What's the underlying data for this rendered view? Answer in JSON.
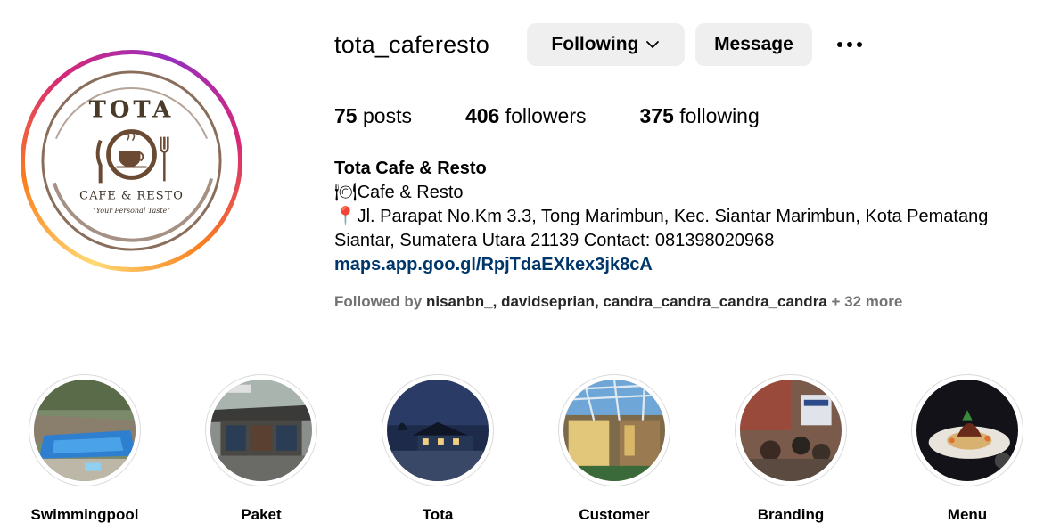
{
  "profile": {
    "username": "tota_caferesto",
    "following_button": "Following",
    "message_button": "Message",
    "logo_text_top": "TOTA",
    "logo_text_mid": "CAFE & RESTO",
    "logo_text_tag": "\"Your Personal Taste\""
  },
  "stats": {
    "posts_count": "75",
    "posts_label": "posts",
    "followers_count": "406",
    "followers_label": "followers",
    "following_count": "375",
    "following_label": "following"
  },
  "bio": {
    "name": "Tota Cafe & Resto",
    "line1_icon": "🍽",
    "line1": "Cafe & Resto",
    "line2_icon": "📍",
    "line2": "Jl. Parapat No.Km 3.3, Tong Marimbun, Kec. Siantar Marimbun, Kota Pematang Siantar, Sumatera Utara 21139 Contact: 081398020968",
    "link": "maps.app.goo.gl/RpjTdaEXkex3jk8cA"
  },
  "followed_by": {
    "prefix": "Followed by",
    "user1": "nisanbn_",
    "user2": "davidseprian",
    "user3": "candra_candra_candra_candra",
    "more": "+ 32 more"
  },
  "highlights": [
    {
      "label": "Swimmingpool"
    },
    {
      "label": "Paket"
    },
    {
      "label": "Tota"
    },
    {
      "label": "Customer"
    },
    {
      "label": "Branding"
    },
    {
      "label": "Menu"
    }
  ],
  "icons": {
    "chevron": "chevron-down-icon",
    "more": "more-options-icon"
  },
  "colors": {
    "link": "#00376b",
    "button_bg": "#efefef",
    "muted": "#737373",
    "logo_brown": "#6b4a33"
  }
}
